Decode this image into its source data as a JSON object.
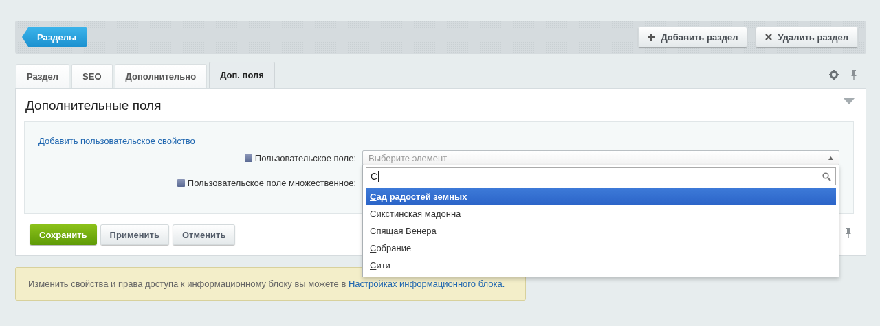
{
  "toolbar": {
    "back_button": "Разделы",
    "buttons": [
      {
        "kind": "add",
        "label": "Добавить раздел"
      },
      {
        "kind": "delete",
        "label": "Удалить раздел"
      }
    ]
  },
  "tabs": [
    {
      "label": "Раздел",
      "selected": false
    },
    {
      "label": "SEO",
      "selected": false
    },
    {
      "label": "Дополнительно",
      "selected": false
    },
    {
      "label": "Доп. поля",
      "selected": true
    }
  ],
  "panel": {
    "title": "Дополнительные поля",
    "add_link": "Добавить пользовательское свойство",
    "fields": [
      {
        "label": "Пользовательское поле:"
      },
      {
        "label": "Пользовательское поле множественное:"
      }
    ],
    "select": {
      "placeholder": "Выберите элемент",
      "search_value": "С",
      "options": [
        {
          "label": "Сад радостей земных",
          "selected": true
        },
        {
          "label": "Сикстинская мадонна",
          "selected": false
        },
        {
          "label": "Спящая Венера",
          "selected": false
        },
        {
          "label": "Собрание",
          "selected": false
        },
        {
          "label": "Сити",
          "selected": false
        }
      ]
    },
    "buttons": [
      {
        "kind": "primary",
        "label": "Сохранить"
      },
      {
        "kind": "default",
        "label": "Применить"
      },
      {
        "kind": "default",
        "label": "Отменить"
      }
    ]
  },
  "note": {
    "text": "Изменить свойства и права доступа к информационному блоку вы можете в",
    "link": "Настройках информационного блока."
  }
}
